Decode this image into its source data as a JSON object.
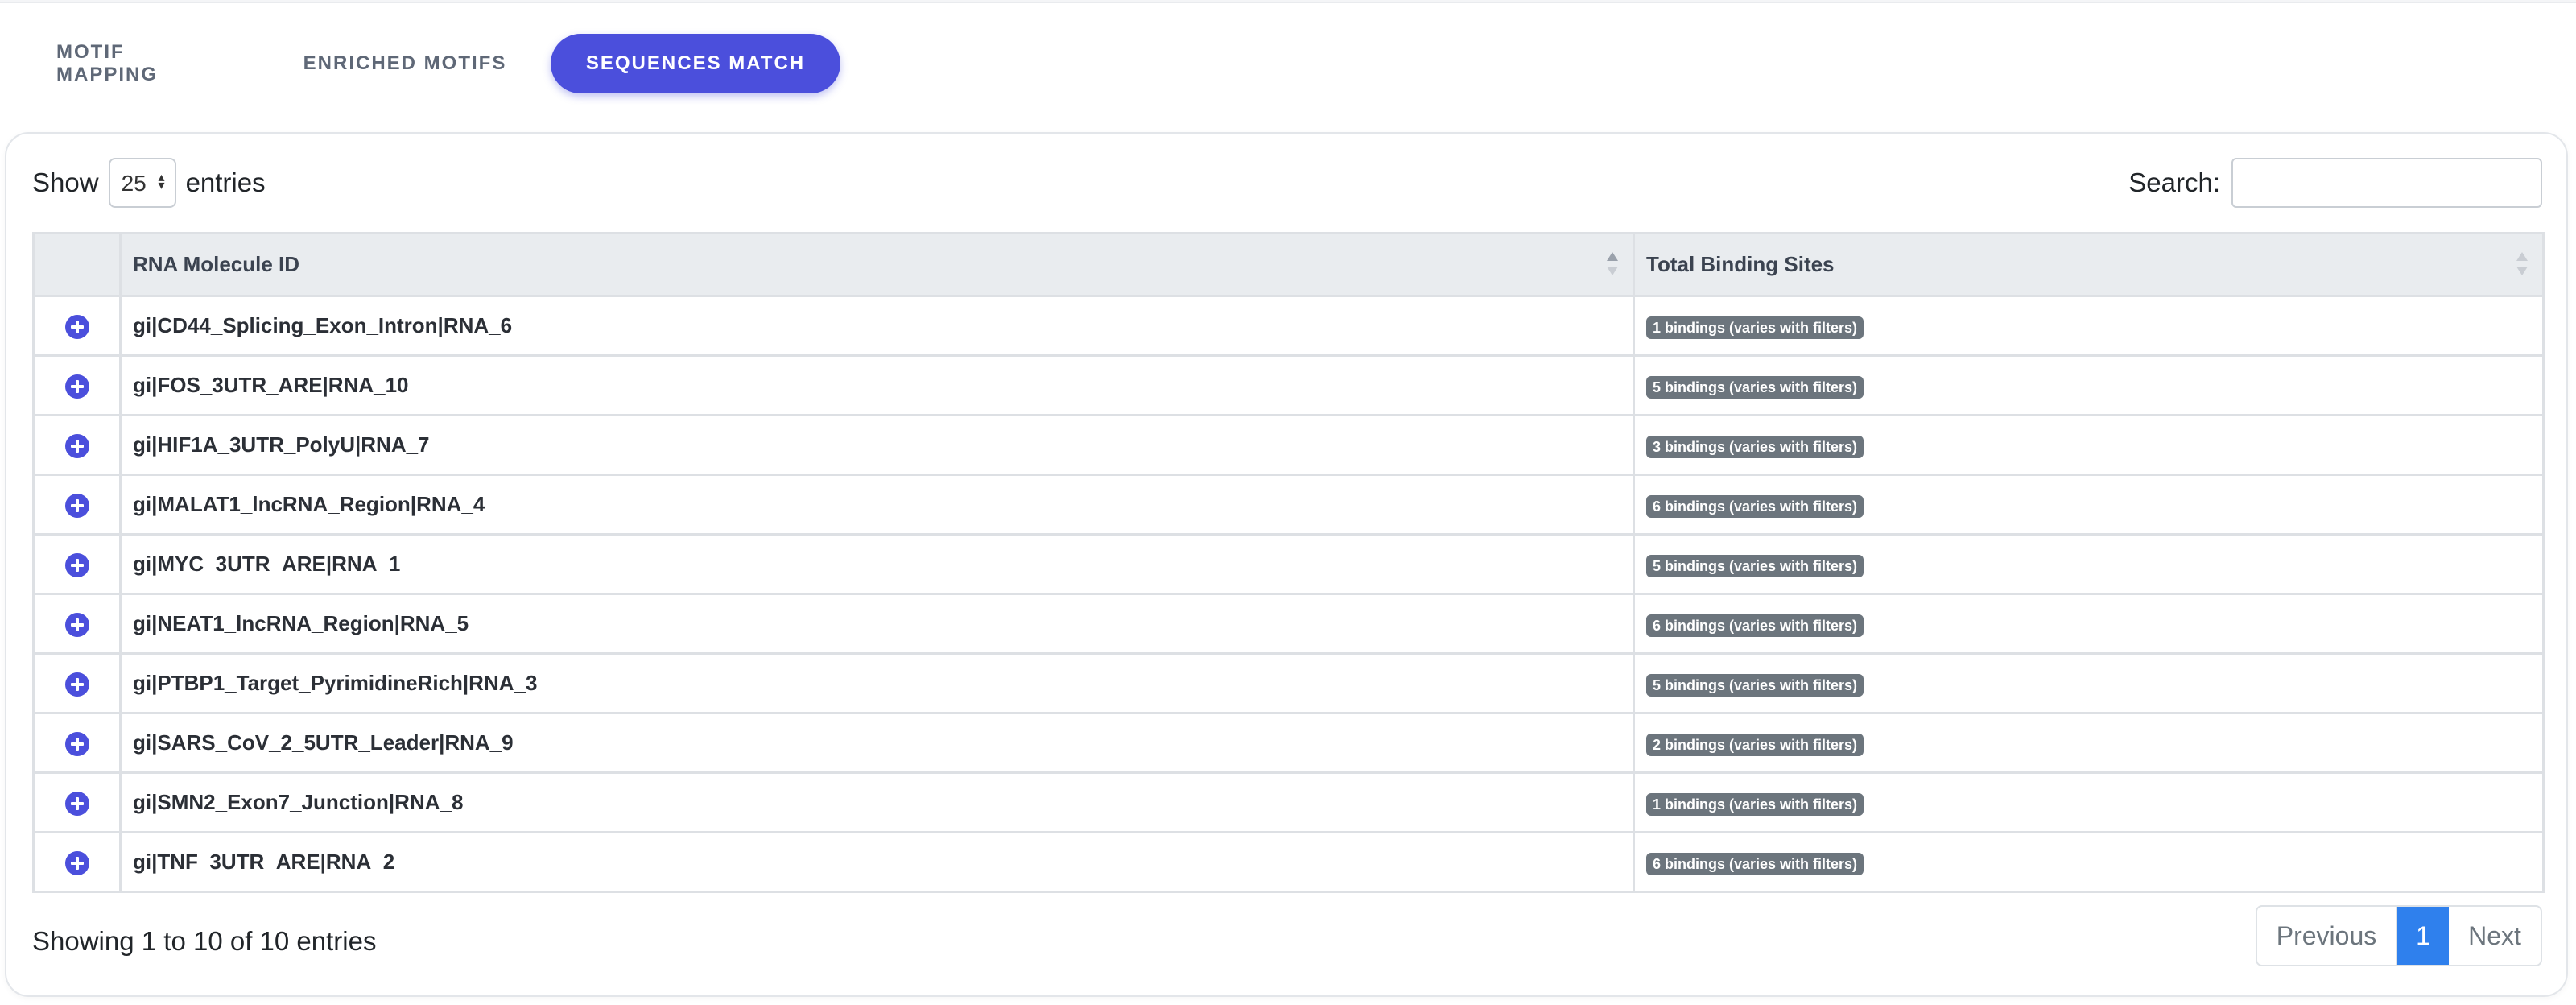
{
  "tabs": [
    {
      "label": "MOTIF MAPPING"
    },
    {
      "label": "ENRICHED MOTIFS"
    },
    {
      "label": "SEQUENCES MATCH"
    }
  ],
  "length_menu": {
    "prefix": "Show",
    "value": "25",
    "suffix": "entries"
  },
  "search": {
    "label": "Search:",
    "value": ""
  },
  "table": {
    "headers": [
      "",
      "RNA Molecule ID",
      "Total Binding Sites"
    ],
    "rows": [
      {
        "id": "gi|CD44_Splicing_Exon_Intron|RNA_6",
        "binding": "1 bindings (varies with filters)"
      },
      {
        "id": "gi|FOS_3UTR_ARE|RNA_10",
        "binding": "5 bindings (varies with filters)"
      },
      {
        "id": "gi|HIF1A_3UTR_PolyU|RNA_7",
        "binding": "3 bindings (varies with filters)"
      },
      {
        "id": "gi|MALAT1_lncRNA_Region|RNA_4",
        "binding": "6 bindings (varies with filters)"
      },
      {
        "id": "gi|MYC_3UTR_ARE|RNA_1",
        "binding": "5 bindings (varies with filters)"
      },
      {
        "id": "gi|NEAT1_lncRNA_Region|RNA_5",
        "binding": "6 bindings (varies with filters)"
      },
      {
        "id": "gi|PTBP1_Target_PyrimidineRich|RNA_3",
        "binding": "5 bindings (varies with filters)"
      },
      {
        "id": "gi|SARS_CoV_2_5UTR_Leader|RNA_9",
        "binding": "2 bindings (varies with filters)"
      },
      {
        "id": "gi|SMN2_Exon7_Junction|RNA_8",
        "binding": "1 bindings (varies with filters)"
      },
      {
        "id": "gi|TNF_3UTR_ARE|RNA_2",
        "binding": "6 bindings (varies with filters)"
      }
    ]
  },
  "info": "Showing 1 to 10 of 10 entries",
  "pagination": {
    "previous": "Previous",
    "current": "1",
    "next": "Next"
  },
  "colors": {
    "accent": "#4b4fdc",
    "page_active": "#2f80ed",
    "badge": "#6c757d"
  }
}
